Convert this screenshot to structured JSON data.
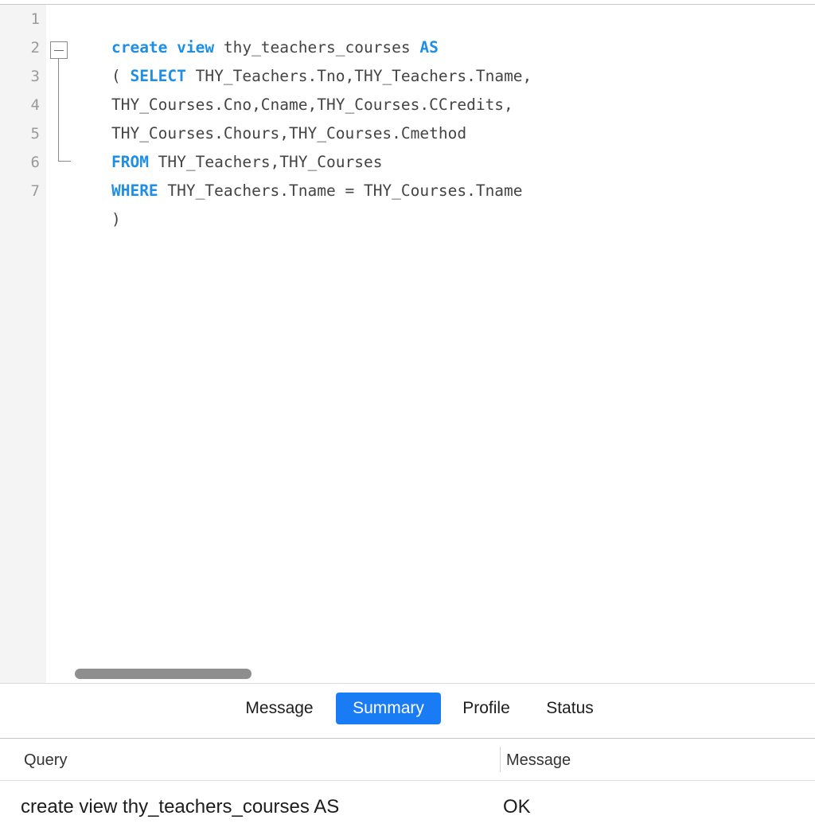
{
  "editor": {
    "line_numbers": [
      "1",
      "2",
      "3",
      "4",
      "5",
      "6",
      "7"
    ],
    "lines": [
      [
        {
          "t": "create view",
          "kw": true
        },
        {
          "t": " thy_teachers_courses "
        },
        {
          "t": "AS",
          "kw": true
        }
      ],
      [
        {
          "t": "( "
        },
        {
          "t": "SELECT",
          "kw": true
        },
        {
          "t": " THY_Teachers.Tno,THY_Teachers.Tname,"
        }
      ],
      [
        {
          "t": "THY_Courses.Cno,Cname,THY_Courses.CCredits,"
        }
      ],
      [
        {
          "t": "THY_Courses.Chours,THY_Courses.Cmethod"
        }
      ],
      [
        {
          "t": "FROM",
          "kw": true
        },
        {
          "t": " THY_Teachers,THY_Courses"
        }
      ],
      [
        {
          "t": "WHERE",
          "kw": true
        },
        {
          "t": " THY_Teachers.Tname = THY_Courses.Tname"
        }
      ],
      [
        {
          "t": ")"
        }
      ]
    ],
    "keyword_color": "#1f8ee5",
    "text_color": "#444444"
  },
  "tabs": [
    {
      "label": "Message",
      "active": false
    },
    {
      "label": "Summary",
      "active": true
    },
    {
      "label": "Profile",
      "active": false
    },
    {
      "label": "Status",
      "active": false
    }
  ],
  "accent_color": "#1a7cf5",
  "results": {
    "columns": [
      "Query",
      "Message"
    ],
    "rows": [
      {
        "query": "create view thy_teachers_courses AS",
        "message": "OK"
      }
    ]
  }
}
